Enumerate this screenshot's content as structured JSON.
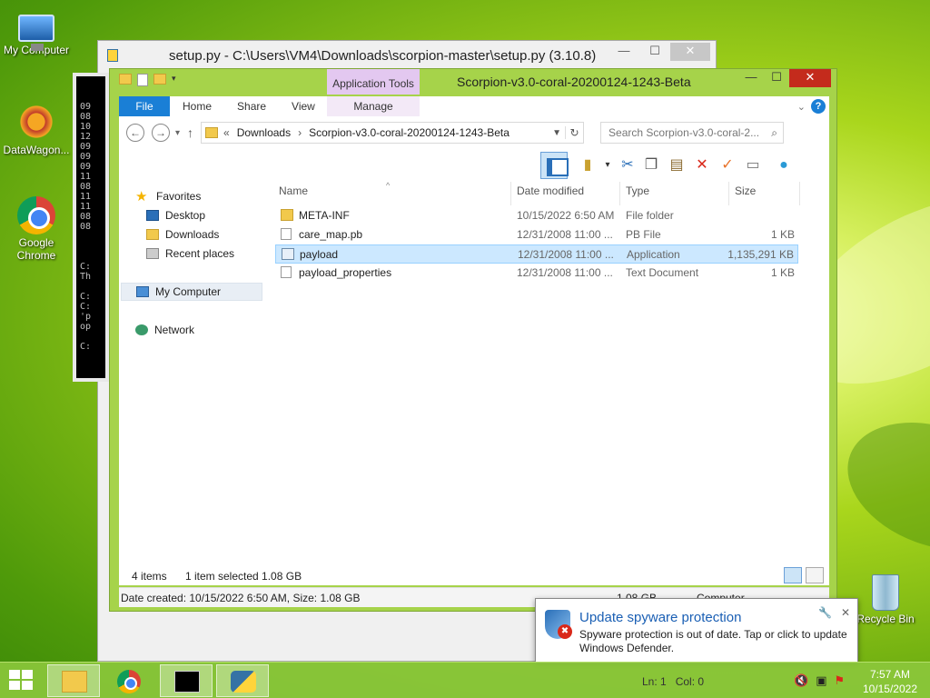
{
  "desktop": {
    "icons": [
      {
        "label": "My Computer",
        "icon": "computer-icon"
      },
      {
        "label": "DataWagon...",
        "icon": "datawagon-icon"
      },
      {
        "label": "Google Chrome",
        "icon": "chrome-icon"
      },
      {
        "label": "Recycle Bin",
        "icon": "recycle-bin-icon"
      }
    ]
  },
  "setup_window": {
    "title": "setup.py - C:\\Users\\VM4\\Downloads\\scorpion-master\\setup.py (3.10.8)",
    "min": "—",
    "max": "☐",
    "close": "✕"
  },
  "cmd_window": {
    "lines": "09\n08\n10\n12\n09\n09\n09\n11\n08\n11\n11\n08\n08\n\n\n\nC:\nTh\n\nC:\nC:\n'p\nop\n\nC:"
  },
  "explorer": {
    "title": "Scorpion-v3.0-coral-20200124-1243-Beta",
    "app_tools": "Application Tools",
    "ribbon_tabs": {
      "file": "File",
      "home": "Home",
      "share": "Share",
      "view": "View",
      "manage": "Manage"
    },
    "help": "?",
    "address": {
      "prefix": "«",
      "crumbs": [
        "Downloads",
        "Scorpion-v3.0-coral-20200124-1243-Beta"
      ],
      "separator": "›"
    },
    "search_placeholder": "Search Scorpion-v3.0-coral-2...",
    "nav": {
      "favorites": "Favorites",
      "desktop": "Desktop",
      "downloads": "Downloads",
      "recent": "Recent places",
      "my_computer": "My Computer",
      "network": "Network"
    },
    "columns": {
      "name": "Name",
      "date": "Date modified",
      "type": "Type",
      "size": "Size"
    },
    "files": [
      {
        "name": "META-INF",
        "date": "10/15/2022 6:50 AM",
        "type": "File folder",
        "size": "",
        "icon": "folder-icon"
      },
      {
        "name": "care_map.pb",
        "date": "12/31/2008 11:00 ...",
        "type": "PB File",
        "size": "1 KB",
        "icon": "file-icon"
      },
      {
        "name": "payload",
        "date": "12/31/2008 11:00 ...",
        "type": "Application",
        "size": "1,135,291 KB",
        "icon": "application-icon"
      },
      {
        "name": "payload_properties",
        "date": "12/31/2008 11:00 ...",
        "type": "Text Document",
        "size": "1 KB",
        "icon": "text-file-icon"
      }
    ],
    "status": {
      "count": "4 items",
      "selection": "1 item selected  1.08 GB"
    },
    "details": {
      "info": "Date created: 10/15/2022 6:50 AM, Size: 1.08 GB",
      "size": "1.08 GB",
      "location": "Computer"
    }
  },
  "notification": {
    "title": "Update spyware protection",
    "message": "Spyware protection is out of date. Tap or click to update Windows Defender."
  },
  "taskbar": {
    "lncol": "Ln: 1   Col: 0",
    "time": "7:57 AM",
    "date": "10/15/2022"
  }
}
